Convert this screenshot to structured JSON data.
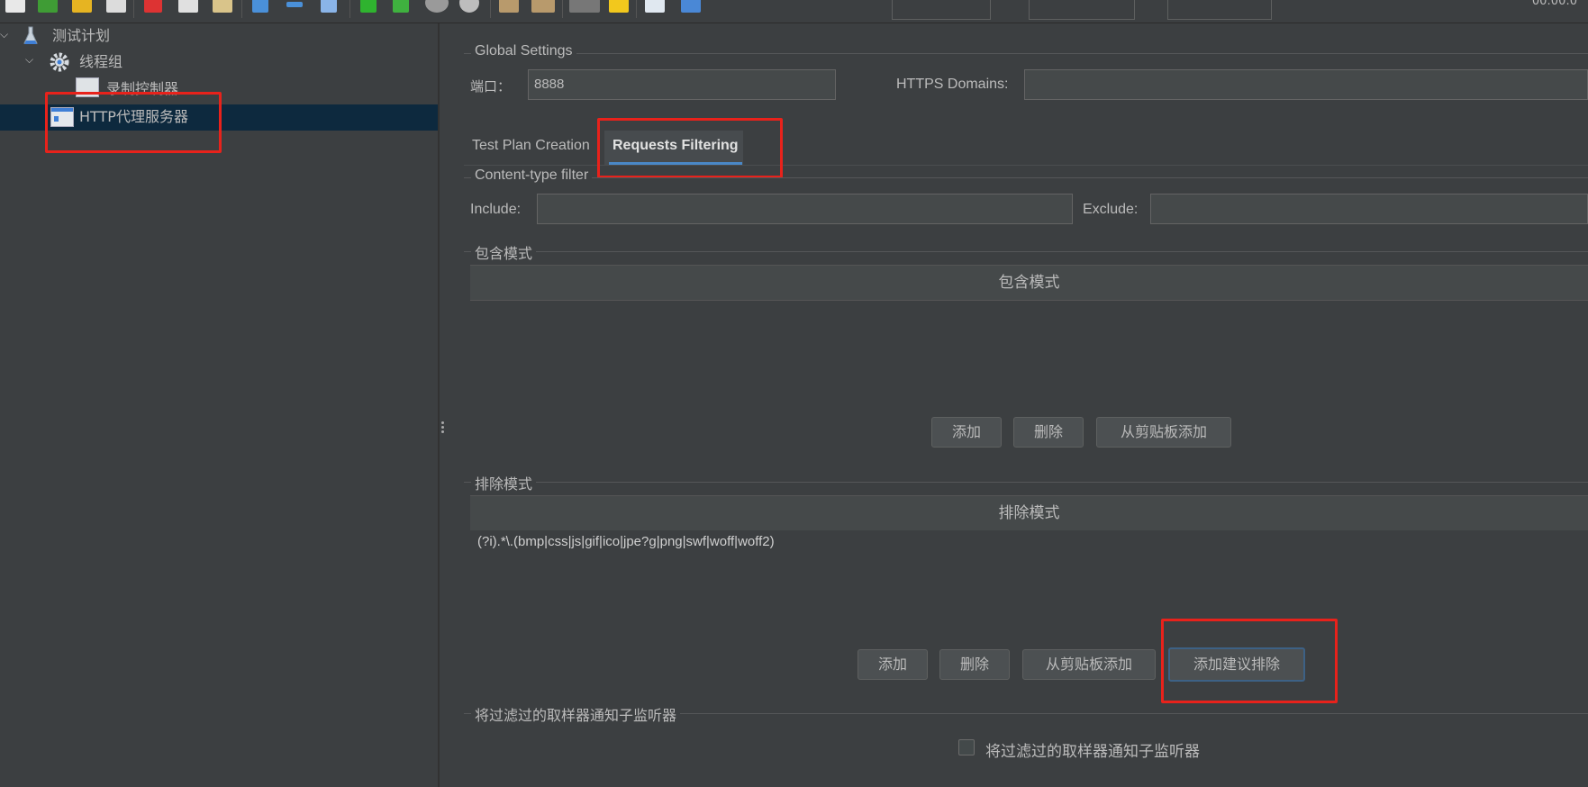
{
  "toolbar": {
    "timer": "00:00:0"
  },
  "tree": {
    "items": [
      {
        "label": "测试计划"
      },
      {
        "label": "线程组"
      },
      {
        "label": "录制控制器"
      },
      {
        "label": "HTTP代理服务器"
      }
    ]
  },
  "global_settings": {
    "legend": "Global Settings",
    "port_label": "端口：",
    "port_value": "8888",
    "https_label": "HTTPS Domains:",
    "https_value": ""
  },
  "tabs": [
    {
      "label": "Test Plan Creation"
    },
    {
      "label": "Requests Filtering",
      "selected": true
    }
  ],
  "content_type_filter": {
    "legend": "Content-type filter",
    "include_label": "Include:",
    "include_value": "",
    "exclude_label": "Exclude:",
    "exclude_value": ""
  },
  "include_patterns": {
    "legend": "包含模式",
    "column_header": "包含模式",
    "rows": [],
    "buttons": {
      "add": "添加",
      "delete": "删除",
      "add_from_clipboard": "从剪贴板添加"
    }
  },
  "exclude_patterns": {
    "legend": "排除模式",
    "column_header": "排除模式",
    "rows": [
      "(?i).*\\.(bmp|css|js|gif|ico|jpe?g|png|swf|woff|woff2)"
    ],
    "buttons": {
      "add": "添加",
      "delete": "删除",
      "add_from_clipboard": "从剪贴板添加",
      "add_suggested": "添加建议排除"
    }
  },
  "notify_section": {
    "legend": "将过滤过的取样器通知子监听器",
    "checkbox_label": "将过滤过的取样器通知子监听器",
    "checked": false
  },
  "colors": {
    "background": "#3c3f41",
    "field": "#45494a",
    "selection": "#0d293e",
    "accent": "#4a88c7",
    "highlight_box": "#e8221b"
  }
}
